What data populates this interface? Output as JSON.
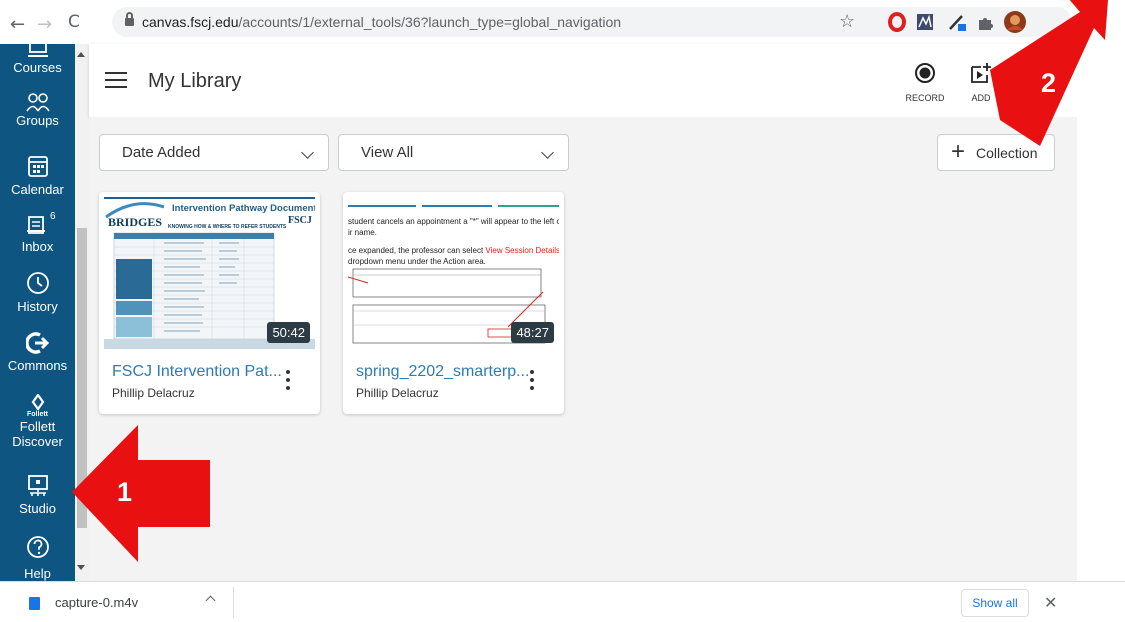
{
  "browser": {
    "url_host": "canvas.fscj.edu",
    "url_path": "/accounts/1/external_tools/36?launch_type=global_navigation",
    "back_glyph": "←",
    "forward_glyph": "→",
    "reload_glyph": "C",
    "star_glyph": "☆",
    "extensions": [
      "opera-icon",
      "extension-icon",
      "pen-icon",
      "puzzle-icon",
      "profile-avatar"
    ]
  },
  "leftnav": {
    "items": [
      {
        "label": "Courses",
        "icon": "courses-icon"
      },
      {
        "label": "Groups",
        "icon": "groups-icon"
      },
      {
        "label": "Calendar",
        "icon": "calendar-icon"
      },
      {
        "label": "Inbox",
        "icon": "inbox-icon",
        "badge": "6"
      },
      {
        "label": "History",
        "icon": "history-icon"
      },
      {
        "label": "Commons",
        "icon": "commons-icon"
      },
      {
        "label": "Follett",
        "sublabel": "Follett",
        "sublabel2": "Discover",
        "icon": "follett-icon"
      },
      {
        "label": "Studio",
        "icon": "studio-icon"
      },
      {
        "label": "Help",
        "icon": "help-icon"
      }
    ],
    "bg_color": "#0e5582"
  },
  "header": {
    "title": "My Library",
    "record_label": "RECORD",
    "add_label": "ADD"
  },
  "filters": {
    "sort_value": "Date Added",
    "view_value": "View All",
    "collection_label": "Collection"
  },
  "cards": [
    {
      "title": "FSCJ Intervention Pat...",
      "owner": "Phillip Delacruz",
      "duration": "50:42",
      "thumb_heading": "Intervention Pathway Document",
      "thumb_brand": "BRIDGES",
      "thumb_sub": "KNOWING HOW & WHERE TO REFER STUDENTS",
      "thumb_logo": "FSCJ"
    },
    {
      "title": "spring_2202_smarterp...",
      "owner": "Phillip Delacruz",
      "duration": "48:27",
      "thumb_line1": "student cancels an appointment a \"*\" will appear to the left o",
      "thumb_line2": "ir name.",
      "thumb_line3a": "ce expanded, the professor can select ",
      "thumb_line3b": "View Session Details",
      "thumb_line3c": " f",
      "thumb_line4": "dropdown menu under the Action area."
    }
  ],
  "downloads": {
    "filename": "capture-0.m4v",
    "show_all": "Show all",
    "close_glyph": "✕"
  },
  "annotations": {
    "callout_1": "1",
    "callout_2": "2",
    "color": "#e81010"
  }
}
